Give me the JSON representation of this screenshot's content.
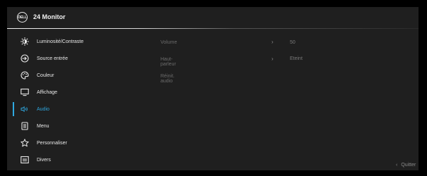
{
  "header": {
    "logo_text": "DELL",
    "title": "24 Monitor"
  },
  "menu": {
    "items": [
      {
        "label": "Luminosité/Contraste",
        "icon": "brightness-icon"
      },
      {
        "label": "Source entrée",
        "icon": "input-source-icon"
      },
      {
        "label": "Couleur",
        "icon": "color-palette-icon"
      },
      {
        "label": "Affichage",
        "icon": "display-icon"
      },
      {
        "label": "Audio",
        "icon": "speaker-icon",
        "active": true
      },
      {
        "label": "Menu",
        "icon": "menu-doc-icon"
      },
      {
        "label": "Personnaliser",
        "icon": "star-icon"
      },
      {
        "label": "Divers",
        "icon": "info-icon"
      }
    ]
  },
  "audio": {
    "volume_label": "Volume",
    "volume_value": "50",
    "speaker_label": "Haut-parleur",
    "speaker_value": "Eteint",
    "reset_label": "Réinit. audio"
  },
  "footer": {
    "quit_label": "Quitter"
  },
  "colors": {
    "accent": "#2fa8e0",
    "panel": "#1f1f1f",
    "background": "#000000"
  }
}
